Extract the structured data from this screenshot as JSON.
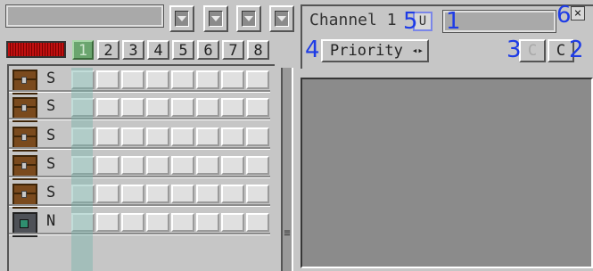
{
  "left_panel": {
    "name_field_value": "",
    "channel_tabs": [
      "1",
      "2",
      "3",
      "4",
      "5",
      "6",
      "7",
      "8"
    ],
    "active_tab": "1",
    "rows": [
      {
        "icon": "chest-icon",
        "mode": "S"
      },
      {
        "icon": "chest-icon",
        "mode": "S"
      },
      {
        "icon": "chest-icon",
        "mode": "S"
      },
      {
        "icon": "chest-icon",
        "mode": "S"
      },
      {
        "icon": "chest-icon",
        "mode": "S"
      },
      {
        "icon": "machine-icon",
        "mode": "N"
      }
    ],
    "divider_handle": "≡"
  },
  "right_panel": {
    "channel_title": "Channel 1",
    "channel_name_value": "",
    "priority_label": "Priority",
    "priority_arrows": "◂▸",
    "button_c_disabled": "C",
    "button_c": "C",
    "toggle_label": "U",
    "close_label": "×"
  },
  "annotations": [
    "1",
    "2",
    "3",
    "4",
    "5",
    "6"
  ],
  "colors": {
    "redstone_bar": "#c01010",
    "active_tab": "#6aa56e",
    "overlay": "#78b4aa"
  }
}
